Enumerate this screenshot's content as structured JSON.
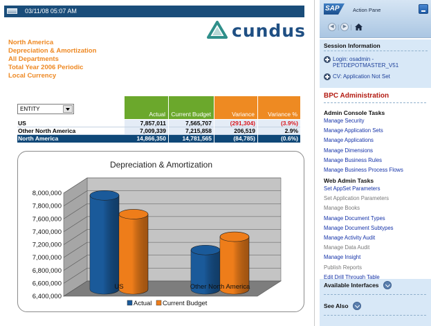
{
  "report": {
    "timestamp": "03/11/08 05:07 AM",
    "logo_text": "cundus",
    "header_lines": [
      "North America",
      "Depreciation & Amortization",
      "All Departments",
      "Total Year 2006 Periodic",
      "Local Currency"
    ],
    "entity_dropdown": "ENTITY",
    "columns": [
      "Actual",
      "Current Budget",
      "Variance",
      "Variance %"
    ],
    "rows": [
      {
        "name": "US",
        "actual": "7,857,011",
        "budget": "7,565,707",
        "variance": "(291,304)",
        "variance_pct": "(3.9%)"
      },
      {
        "name": "Other North America",
        "actual": "7,009,339",
        "budget": "7,215,858",
        "variance": "206,519",
        "variance_pct": "2.9%"
      },
      {
        "name": "North America",
        "actual": "14,866,350",
        "budget": "14,781,565",
        "variance": "(84,785)",
        "variance_pct": "(0.6%)"
      }
    ],
    "colors": {
      "header_orange": "#ee8822",
      "green_header": "#6ba82c",
      "orange_header": "#ee8a22",
      "total_row": "#0f4878",
      "negative": "#d8161e"
    }
  },
  "chart_data": {
    "type": "bar",
    "title": "Depreciation & Amortization",
    "categories": [
      "US",
      "Other North America"
    ],
    "series": [
      {
        "name": "Actual",
        "values": [
          7857011,
          7009339
        ],
        "color": "#1a5a9a"
      },
      {
        "name": "Current Budget",
        "values": [
          7565707,
          7215858
        ],
        "color": "#ee7d1a"
      }
    ],
    "y_ticks": [
      "8,000,000",
      "7,800,000",
      "7,600,000",
      "7,400,000",
      "7,200,000",
      "7,000,000",
      "6,800,000",
      "6,600,000",
      "6,400,000"
    ],
    "ylim": [
      6400000,
      8000000
    ],
    "legend_position": "bottom",
    "grid": true,
    "style": "3d-cylinder"
  },
  "pane": {
    "title": "Action Pane",
    "session": {
      "title": "Session Information",
      "login": "Login: osadmin - PETDEPOTMASTER_V51",
      "cv": "CV: Application Not Set"
    },
    "bpc_title": "BPC Administration",
    "admin_console": {
      "title": "Admin Console Tasks",
      "links": [
        "Manage Security",
        "Manage Application Sets",
        "Manage Applications",
        "Manage Dimensions",
        "Manage Business Rules",
        "Manage Business Process Flows"
      ]
    },
    "web_admin": {
      "title": "Web Admin Tasks",
      "links": [
        {
          "label": "Set AppSet Parameters",
          "enabled": true
        },
        {
          "label": "Set Application Parameters",
          "enabled": false
        },
        {
          "label": "Manage Books",
          "enabled": false
        },
        {
          "label": "Manage Document Types",
          "enabled": true
        },
        {
          "label": "Manage Document Subtypes",
          "enabled": true
        },
        {
          "label": "Manage Activity Audit",
          "enabled": true
        },
        {
          "label": "Manage Data Audit",
          "enabled": false
        },
        {
          "label": "Manage Insight",
          "enabled": true
        },
        {
          "label": "Publish Reports",
          "enabled": false
        },
        {
          "label": "Edit Drill Through Table",
          "enabled": true
        }
      ]
    },
    "available_interfaces": "Available Interfaces",
    "see_also": "See Also"
  }
}
